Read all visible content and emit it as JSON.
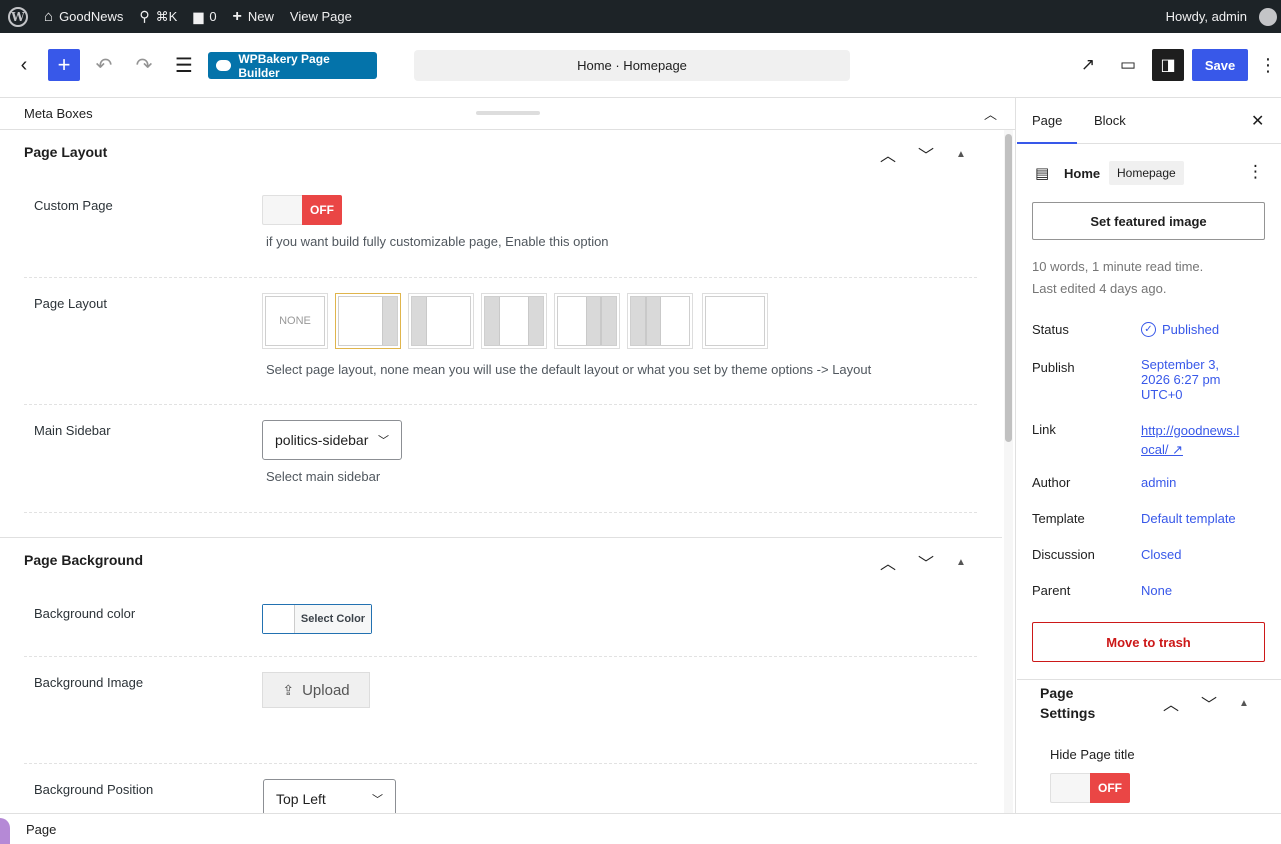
{
  "adminbar": {
    "site_name": "GoodNews",
    "search_shortcut": "⌘K",
    "comments_count": "0",
    "new_label": "New",
    "view_page_label": "View Page",
    "howdy": "Howdy, admin"
  },
  "header": {
    "wpbakery_label": "WPBakery Page Builder",
    "document_title": "Home · Homepage",
    "save_label": "Save"
  },
  "meta": {
    "title": "Meta Boxes",
    "page_layout_section": {
      "title": "Page Layout",
      "custom_page_label": "Custom Page",
      "custom_page_toggle": "OFF",
      "custom_page_help": "if you want build fully customizable page, Enable this option",
      "page_layout_label": "Page Layout",
      "layout_none": "NONE",
      "page_layout_help": "Select page layout, none mean you will use the default layout or what you set by theme options -> Layout",
      "main_sidebar_label": "Main Sidebar",
      "main_sidebar_value": "politics-sidebar",
      "main_sidebar_help": "Select main sidebar"
    },
    "page_background_section": {
      "title": "Page Background",
      "bg_color_label": "Background color",
      "select_color": "Select Color",
      "bg_image_label": "Background Image",
      "upload_label": "Upload",
      "bg_position_label": "Background Position",
      "bg_position_value": "Top Left"
    }
  },
  "sidebar": {
    "tabs": [
      "Page",
      "Block"
    ],
    "doc_title": "Home",
    "doc_badge": "Homepage",
    "featured_image_label": "Set featured image",
    "word_count": "10 words, 1 minute read time.",
    "last_edited": "Last edited 4 days ago.",
    "rows": {
      "status_label": "Status",
      "status_value": "Published",
      "publish_label": "Publish",
      "publish_value_1": "September 3,",
      "publish_value_2": "2026 6:27 pm",
      "publish_value_3": "UTC+0",
      "link_label": "Link",
      "link_value_1": "http://goodnews.l",
      "link_value_2": "ocal/ ↗",
      "author_label": "Author",
      "author_value": "admin",
      "template_label": "Template",
      "template_value": "Default template",
      "discussion_label": "Discussion",
      "discussion_value": "Closed",
      "parent_label": "Parent",
      "parent_value": "None"
    },
    "trash_label": "Move to trash",
    "page_settings_1": "Page",
    "page_settings_2": "Settings",
    "hide_title_label": "Hide Page title",
    "hide_title_toggle": "OFF"
  },
  "footer": {
    "breadcrumb": "Page"
  },
  "colors": {
    "accent": "#3858e9",
    "wpbakery": "#0473aa",
    "toggle_off": "#ea4645",
    "admin_bar": "#1d2327"
  }
}
